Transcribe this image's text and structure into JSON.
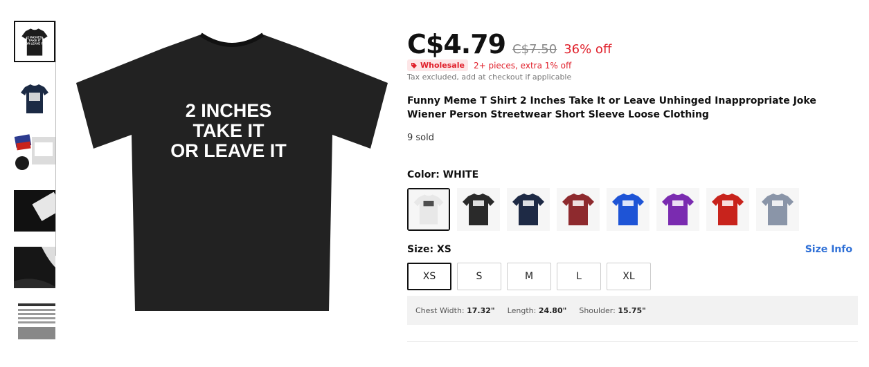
{
  "gallery": {
    "thumbnails": [
      {
        "name": "thumb-black-tee",
        "color": "#1c1c1c"
      },
      {
        "name": "thumb-navy-tee",
        "color": "#1b2a44"
      },
      {
        "name": "thumb-fabric-collage",
        "color": "#dcdcdc"
      },
      {
        "name": "thumb-print-closeup",
        "color": "#111111"
      },
      {
        "name": "thumb-fabric-detail",
        "color": "#161616"
      },
      {
        "name": "thumb-size-chart",
        "color": "#ffffff"
      }
    ],
    "main_print": [
      "2 INCHES",
      "TAKE IT",
      "OR LEAVE IT"
    ],
    "thumb_print": [
      "2 INCHES",
      "TAKE IT",
      "OR LEAVE IT"
    ]
  },
  "price": {
    "current": "C$4.79",
    "original": "C$7.50",
    "discount": "36% off"
  },
  "wholesale": {
    "badge": "Wholesale",
    "text": "2+ pieces, extra 1% off"
  },
  "tax_note": "Tax excluded, add at checkout if applicable",
  "title": "Funny Meme T Shirt 2 Inches Take It or Leave Unhinged Inappropriate Joke Wiener Person Streetwear Short Sleeve Loose Clothing",
  "sold": "9 sold",
  "color": {
    "label": "Color: WHITE",
    "options": [
      {
        "name": "white",
        "hex": "#e8e8e8",
        "text": "#333"
      },
      {
        "name": "black",
        "hex": "#2a2a2a",
        "text": "#fff"
      },
      {
        "name": "navy",
        "hex": "#1e2a45",
        "text": "#fff"
      },
      {
        "name": "burgundy",
        "hex": "#8e2a2e",
        "text": "#fff"
      },
      {
        "name": "royal-blue",
        "hex": "#1e54d6",
        "text": "#fff"
      },
      {
        "name": "purple",
        "hex": "#7a2bb0",
        "text": "#fff"
      },
      {
        "name": "red",
        "hex": "#c8231c",
        "text": "#fff"
      },
      {
        "name": "gray",
        "hex": "#8a95a8",
        "text": "#fff"
      }
    ],
    "selected": "white"
  },
  "size": {
    "label": "Size: XS",
    "info_link": "Size Info",
    "options": [
      "XS",
      "S",
      "M",
      "L",
      "XL"
    ],
    "selected": "XS"
  },
  "measurements": {
    "chest_label": "Chest Width:",
    "chest_value": "17.32\"",
    "length_label": "Length:",
    "length_value": "24.80\"",
    "shoulder_label": "Shoulder:",
    "shoulder_value": "15.75\""
  },
  "icons": {
    "wholesale": "tag-icon"
  }
}
